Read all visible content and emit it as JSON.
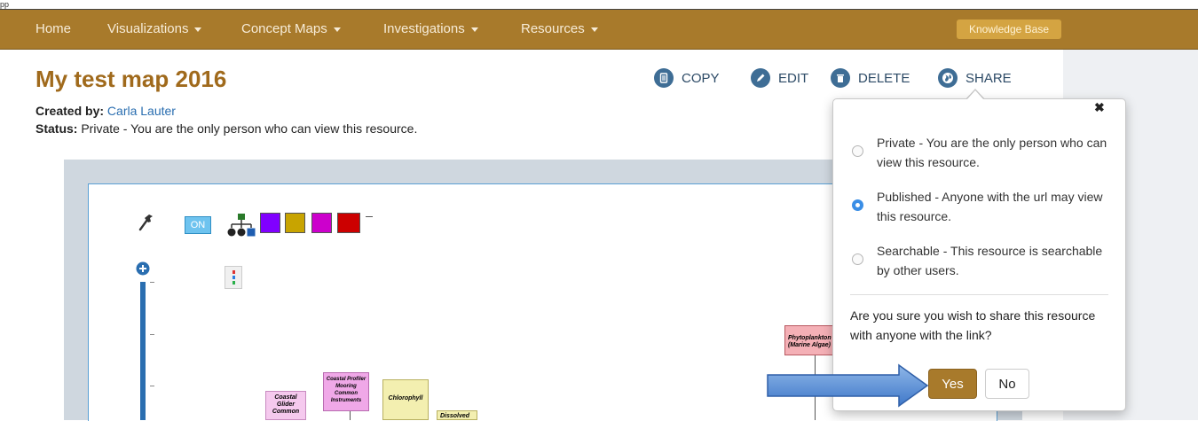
{
  "app_title": "pp",
  "navbar": {
    "items": [
      {
        "label": "Home",
        "dropdown": false
      },
      {
        "label": "Visualizations",
        "dropdown": true
      },
      {
        "label": "Concept Maps",
        "dropdown": true
      },
      {
        "label": "Investigations",
        "dropdown": true
      },
      {
        "label": "Resources",
        "dropdown": true
      }
    ],
    "knowledge_base": "Knowledge Base"
  },
  "map": {
    "title": "My test map 2016",
    "created_by_label": "Created by:",
    "author": "Carla Lauter",
    "status_label": "Status:",
    "status_text": "Private - You are the only person who can view this resource."
  },
  "actions": {
    "copy": "COPY",
    "edit": "EDIT",
    "delete": "DELETE",
    "share": "SHARE"
  },
  "toolbar": {
    "toggle_label": "ON",
    "swatches": [
      "#8000ff",
      "#c8a400",
      "#cc00cc",
      "#cc0000"
    ]
  },
  "canvas_nodes": [
    {
      "label": "Coastal Glider Common",
      "color": "#f5c9ee"
    },
    {
      "label": "Coastal Profiler Mooring Common Instruments",
      "color": "#f0a8e8"
    },
    {
      "label": "Chlorophyll",
      "color": "#f3efb0"
    },
    {
      "label": "Dissolved",
      "color": "#f3efb0"
    },
    {
      "label": "Phytoplankton (Marine Algae)",
      "color": "#f4b0b6"
    }
  ],
  "share_popover": {
    "close": "✖",
    "options": [
      {
        "label": "Private - You are the only person who can view this resource.",
        "selected": false
      },
      {
        "label": "Published - Anyone with the url may view this resource.",
        "selected": true
      },
      {
        "label": "Searchable - This resource is searchable by other users.",
        "selected": false
      }
    ],
    "question": "Are you sure you wish to share this resource with anyone with the link?",
    "yes": "Yes",
    "no": "No"
  },
  "colors": {
    "navbar": "#a87a2b",
    "title": "#a06a1c",
    "link": "#2a6eb0",
    "action_icon": "#3e6d95",
    "radio_selected": "#3a8ee6"
  }
}
